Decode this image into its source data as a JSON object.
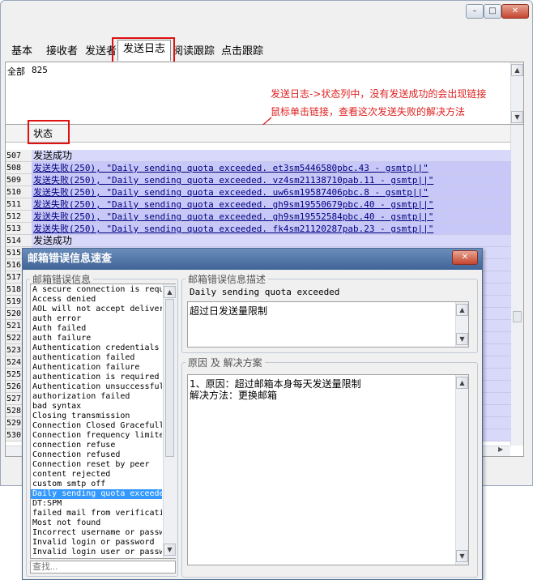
{
  "tabs": [
    "基本",
    "接收者",
    "发送者",
    "发送日志",
    "阅读跟踪",
    "点击跟踪"
  ],
  "summary": {
    "label": "全部",
    "count": "825"
  },
  "column_header": "状态",
  "annotation": {
    "line1": "发送日志->状态列中，没有发送成功的会出现链接",
    "line2": "鼠标单击链接，查看这次发送失败的解决方法"
  },
  "rows": [
    {
      "num": "507",
      "text": "发送成功",
      "type": "ok"
    },
    {
      "num": "508",
      "text": "发送失败(250), \"Daily sending quota exceeded. et3sm5446580pbc.43 - gsmtp||\"",
      "type": "fail"
    },
    {
      "num": "509",
      "text": "发送失败(250), \"Daily sending quota exceeded. vz4sm21138710pab.11 - gsmtp||\"",
      "type": "fail"
    },
    {
      "num": "510",
      "text": "发送失败(250), \"Daily sending quota exceeded. uw6sm19587406pbc.8 - gsmtp||\"",
      "type": "fail"
    },
    {
      "num": "511",
      "text": "发送失败(250), \"Daily sending quota exceeded. gh9sm19550679pbc.40 - gsmtp||\"",
      "type": "fail"
    },
    {
      "num": "512",
      "text": "发送失败(250), \"Daily sending quota exceeded. gh9sm19552584pbc.40 - gsmtp||\"",
      "type": "fail"
    },
    {
      "num": "513",
      "text": "发送失败(250), \"Daily sending quota exceeded. fk4sm21120287pab.23 - gsmtp||\"",
      "type": "fail"
    },
    {
      "num": "514",
      "text": "发送成功",
      "type": "ok"
    },
    {
      "num": "515",
      "text": "",
      "type": "ok"
    },
    {
      "num": "516",
      "text": "",
      "type": "ok"
    },
    {
      "num": "517",
      "text": "",
      "type": "ok"
    },
    {
      "num": "518",
      "text": "",
      "type": "ok"
    },
    {
      "num": "519",
      "text": "",
      "type": "ok"
    },
    {
      "num": "520",
      "text": "",
      "type": "ok"
    },
    {
      "num": "521",
      "text": "",
      "type": "ok"
    },
    {
      "num": "522",
      "text": "",
      "type": "ok"
    },
    {
      "num": "523",
      "text": "",
      "type": "ok"
    },
    {
      "num": "524",
      "text": "",
      "type": "ok"
    },
    {
      "num": "525",
      "text": "",
      "type": "ok"
    },
    {
      "num": "526",
      "text": "",
      "type": "ok"
    },
    {
      "num": "527",
      "text": "",
      "type": "ok"
    },
    {
      "num": "528",
      "text": "",
      "type": "ok"
    },
    {
      "num": "529",
      "text": "",
      "type": "ok"
    },
    {
      "num": "530",
      "text": "",
      "type": "ok"
    }
  ],
  "dialog": {
    "title": "邮箱错误信息速查",
    "list_group": "邮箱错误信息",
    "desc_group": "邮箱错误信息描述",
    "reason_group": "原因 及 解决方案",
    "errors": [
      "A secure connection is required",
      "Access denied",
      "AOL will not accept delivery",
      "auth error",
      "Auth failed",
      "auth failure",
      "Authentication credentials",
      "authentication failed",
      "Authentication failure",
      "authentication is required",
      "Authentication unsuccessful",
      "authorization failed",
      "bad syntax",
      "Closing transmission",
      "Connection Closed Gracefully",
      "Connection frequency limited",
      "connection refuse",
      "Connection refused",
      "Connection reset by peer",
      "content rejected",
      "custom smtp off",
      "Daily sending quota exceeded",
      "DT:SPM",
      "failed mail from verification",
      "Most not found",
      "Incorrect username or password",
      "Invalid login or password",
      "Invalid login user or password"
    ],
    "selected_index": 21,
    "search_placeholder": "查找...",
    "desc_en": "Daily sending quota exceeded",
    "desc_cn": "超过日发送量限制",
    "reason": "1、原因：超过邮箱本身每天发送量限制",
    "solution": "解决方法：更换邮箱"
  },
  "colors": {
    "red": "#e01010",
    "fail_bg": "#c8c8f8",
    "dialog_title": "#3f6496"
  }
}
